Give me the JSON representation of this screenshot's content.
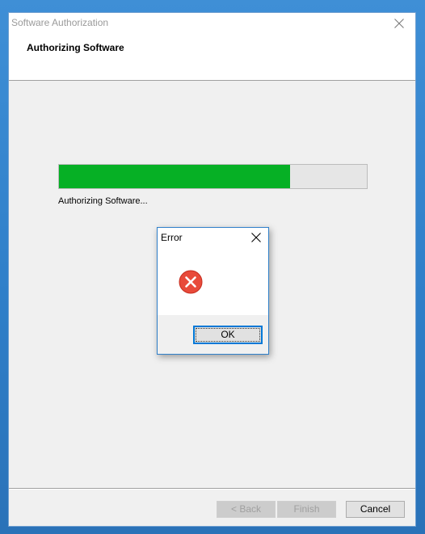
{
  "window": {
    "title": "Software Authorization",
    "header_title": "Authorizing Software",
    "close_icon": "close-icon"
  },
  "progress": {
    "value": 0.75,
    "fill_color": "#06b025",
    "status_text": "Authorizing Software..."
  },
  "buttons": {
    "back_label": "< Back",
    "finish_label": "Finish",
    "cancel_label": "Cancel"
  },
  "error_dialog": {
    "title": "Error",
    "icon": "error-icon",
    "icon_color": "#e81123",
    "ok_label": "OK"
  }
}
